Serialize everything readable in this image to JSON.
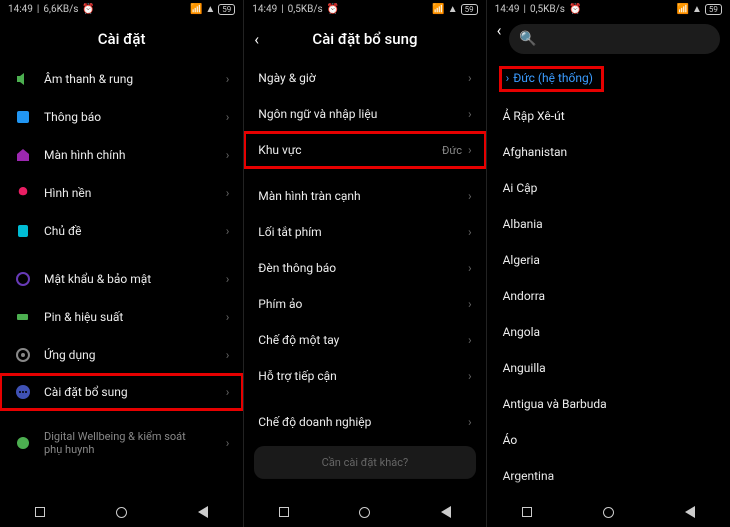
{
  "status": {
    "time": "14:49",
    "net1": "6,6KB/s",
    "net2": "0,5KB/s",
    "net3": "0,5KB/s",
    "alarm": "⏰",
    "signal": "📶",
    "wifi": "📶",
    "battery": "59"
  },
  "panel1": {
    "title": "Cài đặt",
    "groups": [
      {
        "items": [
          {
            "icon": "sound",
            "color": "#4caf50",
            "label": "Âm thanh & rung"
          },
          {
            "icon": "notify",
            "color": "#2196f3",
            "label": "Thông báo"
          },
          {
            "icon": "home",
            "color": "#9c27b0",
            "label": "Màn hình chính"
          },
          {
            "icon": "wallpaper",
            "color": "#e91e63",
            "label": "Hình nền"
          },
          {
            "icon": "theme",
            "color": "#00bcd4",
            "label": "Chủ đề"
          }
        ]
      },
      {
        "items": [
          {
            "icon": "security",
            "color": "#673ab7",
            "label": "Mật khẩu & bảo mật"
          },
          {
            "icon": "battery",
            "color": "#4caf50",
            "label": "Pin & hiệu suất"
          },
          {
            "icon": "apps",
            "color": "#607d8b",
            "label": "Ứng dụng"
          },
          {
            "icon": "more",
            "color": "#3f51b5",
            "label": "Cài đặt bổ sung",
            "highlight": true
          }
        ]
      },
      {
        "items": [
          {
            "icon": "wellbeing",
            "color": "#4caf50",
            "label": "Digital Wellbeing & kiểm soát phụ huynh",
            "multiline": true
          }
        ]
      }
    ]
  },
  "panel2": {
    "title": "Cài đặt bổ sung",
    "groups": [
      {
        "items": [
          {
            "label": "Ngày & giờ"
          },
          {
            "label": "Ngôn ngữ và nhập liệu"
          },
          {
            "label": "Khu vực",
            "value": "Đức",
            "highlight": true
          }
        ]
      },
      {
        "items": [
          {
            "label": "Màn hình tràn cạnh"
          },
          {
            "label": "Lối tắt phím"
          },
          {
            "label": "Đèn thông báo"
          },
          {
            "label": "Phím ảo"
          },
          {
            "label": "Chế độ một tay"
          },
          {
            "label": "Hỗ trợ tiếp cận"
          }
        ]
      },
      {
        "items": [
          {
            "label": "Chế độ doanh nghiệp"
          }
        ]
      }
    ],
    "bottomCard": "Cần cài đặt khác?"
  },
  "panel3": {
    "selected": "Đức (hệ thống)",
    "items": [
      "Ả Rập Xê-út",
      "Afghanistan",
      "Ai Cập",
      "Albania",
      "Algeria",
      "Andorra",
      "Angola",
      "Anguilla",
      "Antigua và Barbuda",
      "Áo",
      "Argentina"
    ]
  }
}
